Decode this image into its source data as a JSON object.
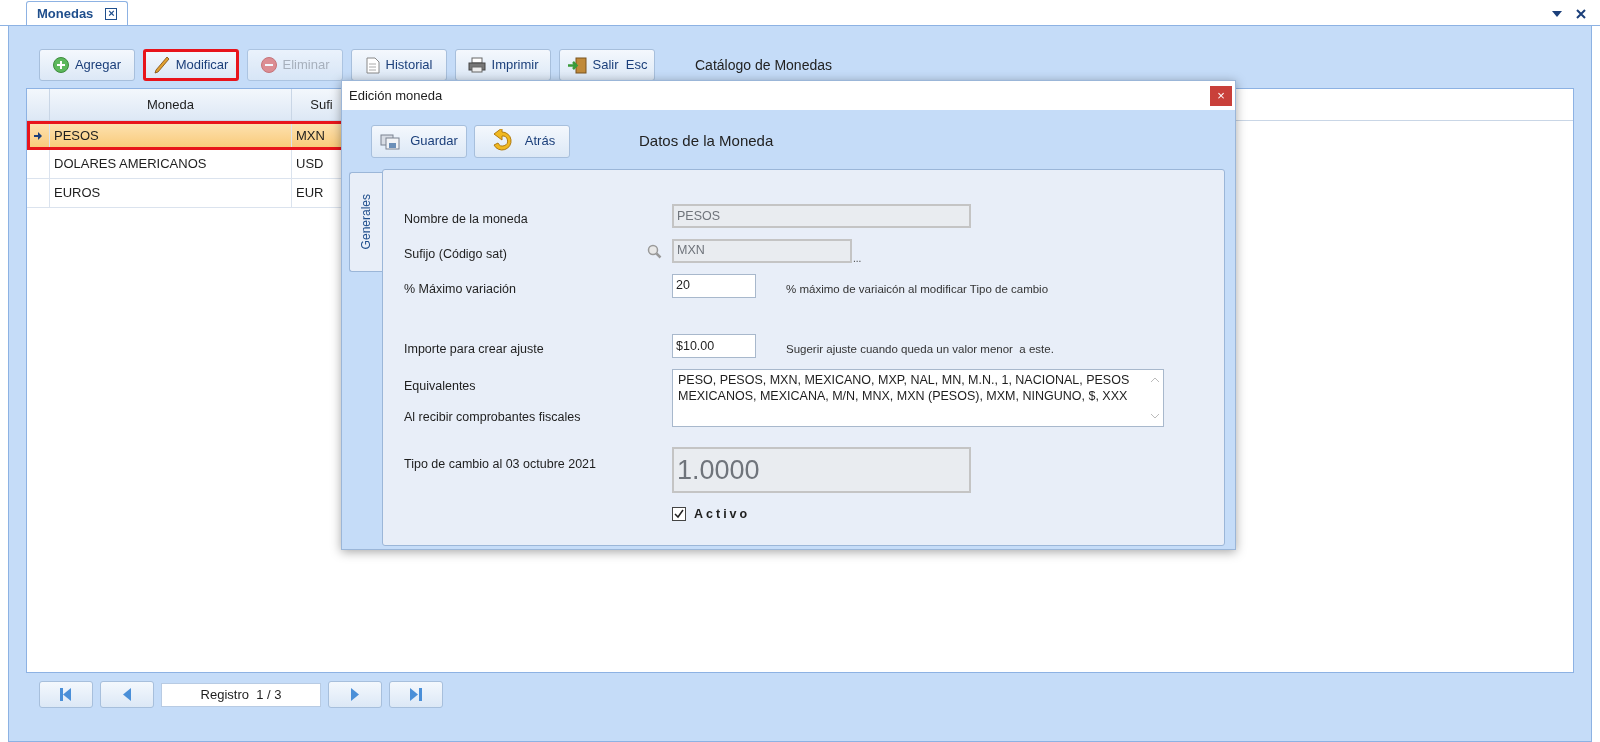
{
  "document_tabs": [
    {
      "label": "Monedas",
      "selected": true,
      "close": "×"
    }
  ],
  "toolbar": {
    "buttons": [
      {
        "label": "Agregar",
        "kind": "add",
        "disabled": false,
        "highlighted": false
      },
      {
        "label": "Modificar",
        "kind": "edit",
        "disabled": false,
        "highlighted": true
      },
      {
        "label": "Eliminar",
        "kind": "delete",
        "disabled": true,
        "highlighted": false
      },
      {
        "label": "Historial",
        "kind": "history",
        "disabled": false,
        "highlighted": false
      },
      {
        "label": "Imprimir",
        "kind": "print",
        "disabled": false,
        "highlighted": false
      },
      {
        "label": "Salir  Esc",
        "kind": "exit",
        "disabled": false,
        "highlighted": false
      }
    ],
    "title": "Catálogo de Monedas"
  },
  "grid": {
    "columns": [
      "Moneda",
      "Sufi"
    ],
    "rows": [
      {
        "cells": [
          "PESOS",
          "MXN"
        ],
        "selected": true,
        "highlighted": true
      },
      {
        "cells": [
          "DOLARES AMERICANOS",
          "USD"
        ],
        "selected": false,
        "highlighted": false
      },
      {
        "cells": [
          "EUROS",
          "EUR"
        ],
        "selected": false,
        "highlighted": false
      }
    ]
  },
  "navigator": {
    "record": "Registro  1 / 3"
  },
  "dialog": {
    "title": "Edición moneda",
    "close": "×",
    "buttons": [
      {
        "label": "Guardar",
        "kind": "save"
      },
      {
        "label": "Atrás",
        "kind": "back"
      }
    ],
    "heading": "Datos de la Moneda",
    "side_tab": "Generales",
    "fields": [
      {
        "kind": "text",
        "label": "Nombre de la moneda",
        "value": "PESOS",
        "disabled": true
      },
      {
        "kind": "lookup",
        "label": "Sufijo (Código sat)",
        "value": "MXN",
        "disabled": true,
        "button": "..."
      },
      {
        "kind": "text",
        "label": "% Máximo variación",
        "value": "20",
        "disabled": false,
        "hint": "% máximo de variaicón al modificar Tipo de cambio"
      },
      {
        "kind": "text",
        "label": "Importe para crear ajuste",
        "value": "$10.00",
        "disabled": false,
        "hint": "Sugerir ajuste cuando queda un valor menor  a este."
      },
      {
        "kind": "textarea",
        "label": "Equivalentes",
        "sublabel": "Al recibir comprobantes fiscales",
        "value": "PESO, PESOS, MXN, MEXICANO, MXP, NAL, MN, M.N., 1, NACIONAL, PESOS MEXICANOS, MEXICANA, M/N, MNX, MXN (PESOS), MXM, NINGUNO, $, XXX",
        "disabled": false
      },
      {
        "kind": "display",
        "label": "Tipo de cambio al 03 octubre 2021",
        "value": "1.0000",
        "disabled": true
      }
    ],
    "active": {
      "label": "Activo",
      "checked": true
    }
  }
}
